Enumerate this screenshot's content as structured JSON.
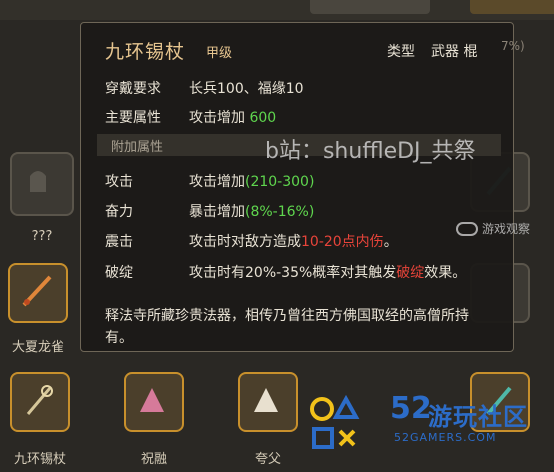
{
  "tooltip": {
    "title": "九环锡杖",
    "grade": "甲级",
    "type_label": "类型",
    "type_value": "武器 棍",
    "pct": "7%)",
    "rows": [
      {
        "label": "穿戴要求",
        "value": "长兵100、福缘10"
      },
      {
        "label": "主要属性",
        "value_prefix": "攻击增加 ",
        "value_num": "600"
      }
    ],
    "sub_header": "附加属性",
    "attrs": [
      {
        "label": "攻击",
        "prefix": "攻击增加",
        "value": "(210-300)"
      },
      {
        "label": "奋力",
        "prefix": "暴击增加",
        "value": "(8%-16%)"
      },
      {
        "label": "震击",
        "prefix": "攻击时对敌方造成",
        "red": "10-20点内伤",
        "suffix": "。"
      },
      {
        "label": "破绽",
        "prefix": "攻击时有20%-35%概率对其触发",
        "red": "破绽",
        "suffix": "效果。"
      }
    ],
    "description": "释法寺所藏珍贵法器，相传乃曾往西方佛国取经的高僧所持有。"
  },
  "grid": {
    "unknown_label": "???",
    "row_labels": [
      "大夏龙雀",
      "九环锡杖",
      "祝融",
      "夸父"
    ]
  },
  "watermarks": {
    "bilibili": "b站：shuffleDJ_共祭",
    "site": "游戏观察",
    "logo_num": "52",
    "logo_cn": "游玩社区",
    "logo_en": "52GAMERS.COM"
  },
  "colors": {
    "accent_green": "#5fd64e",
    "accent_red": "#e8443a",
    "title_gold": "#e7c690",
    "logo_blue": "#2c6cc8"
  }
}
